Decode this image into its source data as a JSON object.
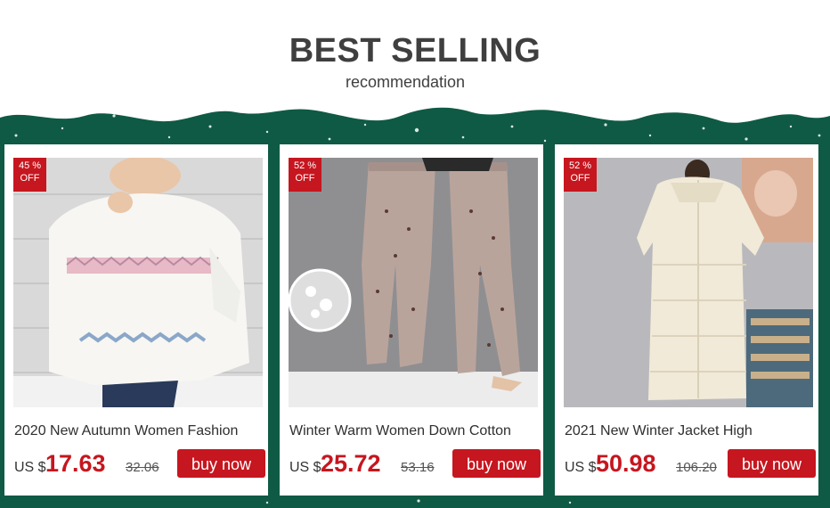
{
  "header": {
    "title": "BEST SELLING",
    "subtitle": "recommendation"
  },
  "colors": {
    "banner": "#0f5a44",
    "accent": "#c6161f"
  },
  "products": [
    {
      "badge_pct": "45 %",
      "badge_off": "OFF",
      "name": "2020 New Autumn Women Fashion",
      "currency": "US $",
      "price": "17.63",
      "old_price": "32.06",
      "button": "buy now",
      "image": "white-knit-sweater-photo"
    },
    {
      "badge_pct": "52 %",
      "badge_off": "OFF",
      "name": "Winter Warm Women Down Cotton",
      "currency": "US $",
      "price": "25.72",
      "old_price": "53.16",
      "button": "buy now",
      "image": "fleece-lined-pants-photo"
    },
    {
      "badge_pct": "52 %",
      "badge_off": "OFF",
      "name": "2021 New Winter Jacket High",
      "currency": "US $",
      "price": "50.98",
      "old_price": "106.20",
      "button": "buy now",
      "image": "long-down-jacket-photo"
    }
  ]
}
